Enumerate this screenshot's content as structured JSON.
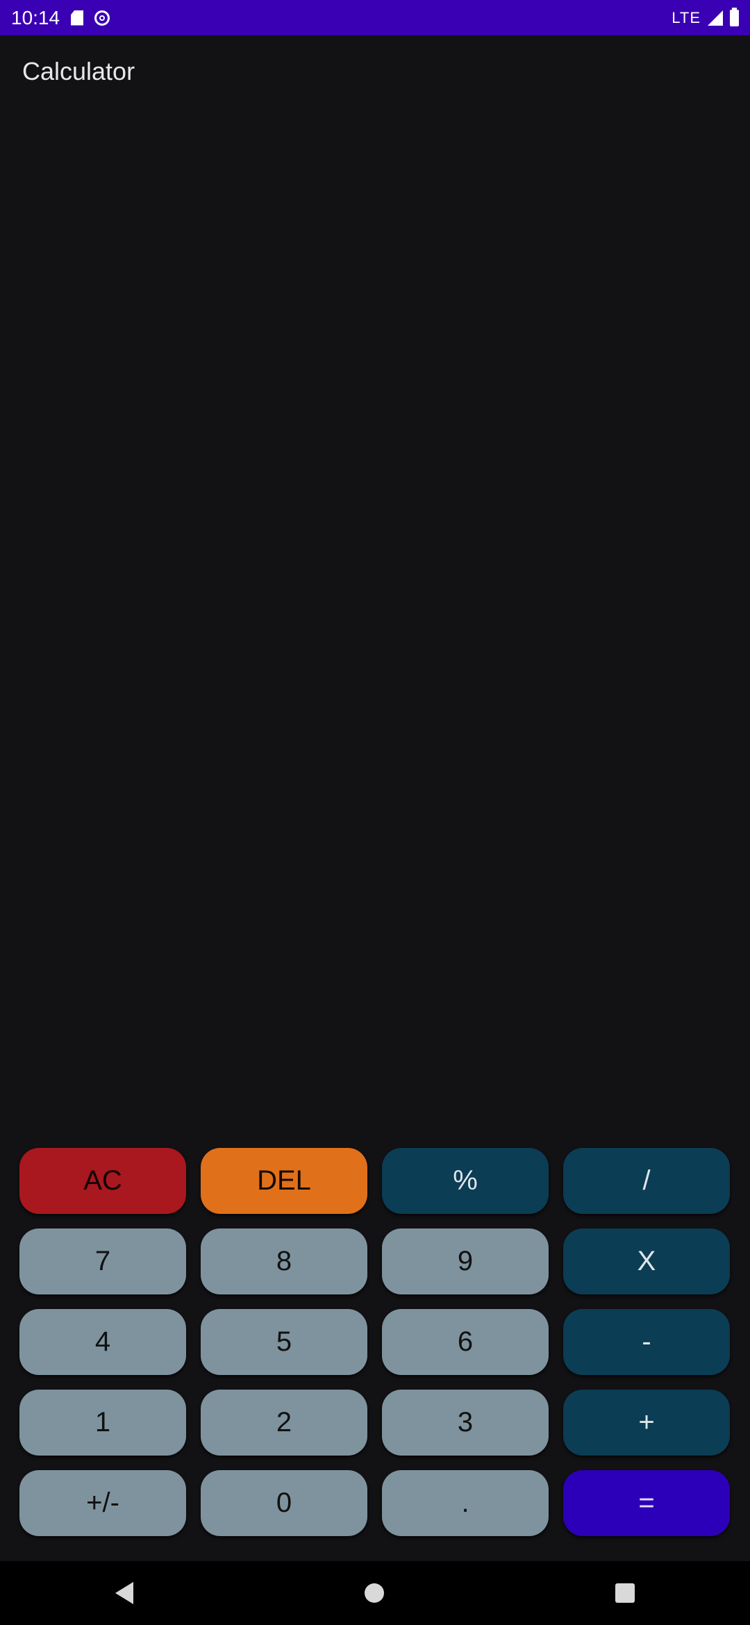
{
  "status_bar": {
    "time": "10:14",
    "network": "LTE",
    "color": "#3a00b3"
  },
  "app": {
    "title": "Calculator"
  },
  "display": {
    "expression": "",
    "result": ""
  },
  "keypad": {
    "rows": [
      [
        {
          "label": "AC",
          "type": "ac",
          "name": "ac-button"
        },
        {
          "label": "DEL",
          "type": "del",
          "name": "del-button"
        },
        {
          "label": "%",
          "type": "op",
          "name": "percent-button"
        },
        {
          "label": "/",
          "type": "op",
          "name": "divide-button"
        }
      ],
      [
        {
          "label": "7",
          "type": "digit",
          "name": "digit-7-button"
        },
        {
          "label": "8",
          "type": "digit",
          "name": "digit-8-button"
        },
        {
          "label": "9",
          "type": "digit",
          "name": "digit-9-button"
        },
        {
          "label": "X",
          "type": "op",
          "name": "multiply-button"
        }
      ],
      [
        {
          "label": "4",
          "type": "digit",
          "name": "digit-4-button"
        },
        {
          "label": "5",
          "type": "digit",
          "name": "digit-5-button"
        },
        {
          "label": "6",
          "type": "digit",
          "name": "digit-6-button"
        },
        {
          "label": "-",
          "type": "op",
          "name": "subtract-button"
        }
      ],
      [
        {
          "label": "1",
          "type": "digit",
          "name": "digit-1-button"
        },
        {
          "label": "2",
          "type": "digit",
          "name": "digit-2-button"
        },
        {
          "label": "3",
          "type": "digit",
          "name": "digit-3-button"
        },
        {
          "label": "+",
          "type": "op",
          "name": "add-button"
        }
      ],
      [
        {
          "label": "+/-",
          "type": "digit",
          "name": "sign-toggle-button"
        },
        {
          "label": "0",
          "type": "digit",
          "name": "digit-0-button"
        },
        {
          "label": ".",
          "type": "digit",
          "name": "decimal-button"
        },
        {
          "label": "=",
          "type": "eq",
          "name": "equals-button"
        }
      ]
    ],
    "colors": {
      "digit": "#7e939e",
      "operator": "#0b3d54",
      "clear": "#a8181e",
      "delete": "#e0701a",
      "equals": "#2c00b8"
    }
  },
  "nav_bar": {
    "back_icon": "back-triangle-icon",
    "home_icon": "home-circle-icon",
    "recent_icon": "recent-square-icon"
  }
}
